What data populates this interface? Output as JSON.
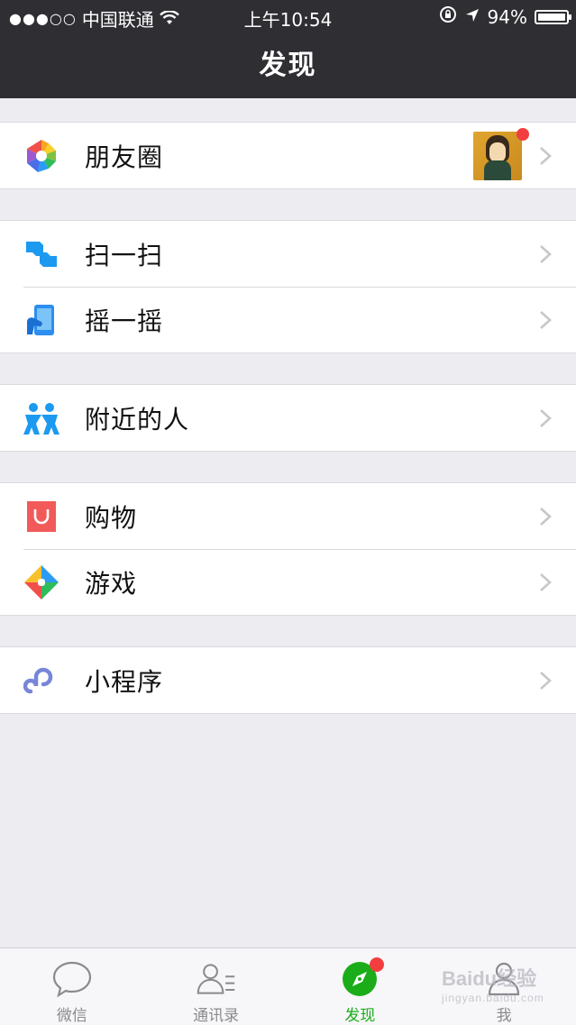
{
  "status_bar": {
    "signal": "●●●○○",
    "carrier": "中国联通",
    "time": "上午10:54",
    "battery": "94%"
  },
  "nav": {
    "title": "发现"
  },
  "groups": [
    {
      "items": [
        {
          "label": "朋友圈",
          "icon": "moments-icon",
          "has_thumb": true,
          "badge": "dot"
        }
      ]
    },
    {
      "items": [
        {
          "label": "扫一扫",
          "icon": "scan-icon"
        },
        {
          "label": "摇一摇",
          "icon": "shake-icon"
        }
      ]
    },
    {
      "items": [
        {
          "label": "附近的人",
          "icon": "people-nearby-icon"
        }
      ]
    },
    {
      "items": [
        {
          "label": "购物",
          "icon": "shopping-icon"
        },
        {
          "label": "游戏",
          "icon": "games-icon"
        }
      ]
    },
    {
      "items": [
        {
          "label": "小程序",
          "icon": "mini-programs-icon"
        }
      ]
    }
  ],
  "tab_bar": {
    "tabs": [
      {
        "label": "微信",
        "icon": "chat-icon",
        "active": false
      },
      {
        "label": "通讯录",
        "icon": "contacts-icon",
        "active": false
      },
      {
        "label": "发现",
        "icon": "discover-compass-icon",
        "active": true,
        "badge": "dot"
      },
      {
        "label": "我",
        "icon": "me-icon",
        "active": false
      }
    ]
  },
  "watermark": {
    "brand": "Baidu经验",
    "url": "jingyan.baidu.com"
  },
  "colors": {
    "accent": "#1aad19",
    "nav_bg": "#2e2e33",
    "badge": "#f23e3e",
    "background": "#ececf1"
  }
}
